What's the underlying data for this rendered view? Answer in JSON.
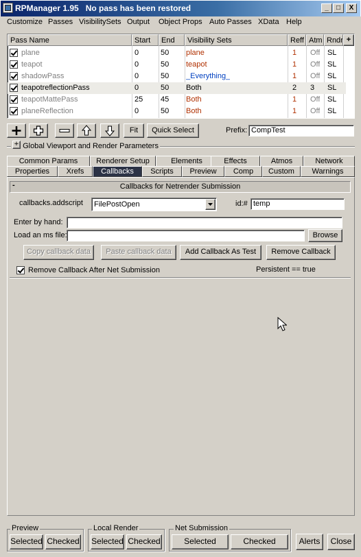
{
  "window": {
    "title": "RPManager 1.95   No pass has been restored",
    "minimize": "_",
    "maximize": "□",
    "close": "X"
  },
  "menu": [
    "Customize",
    "Passes",
    "VisibilitySets",
    "Output",
    "Object Props",
    "Auto Passes",
    "XData",
    "Help"
  ],
  "passes": {
    "headers": {
      "name": "Pass Name",
      "start": "Start",
      "end": "End",
      "vis": "Visibility Sets",
      "reff": "Reff",
      "atm": "Atm",
      "rndr": "Rndr"
    },
    "scroll_glyph": "+",
    "rows": [
      {
        "name": "plane",
        "start": "0",
        "end": "50",
        "vis": "plane",
        "reff": "1",
        "atm": "Off",
        "rndr": "SL"
      },
      {
        "name": "teapot",
        "start": "0",
        "end": "50",
        "vis": "teapot",
        "reff": "1",
        "atm": "Off",
        "rndr": "SL"
      },
      {
        "name": "shadowPass",
        "start": "0",
        "end": "50",
        "vis": "_Everything_",
        "reff": "1",
        "atm": "Off",
        "rndr": "SL"
      },
      {
        "name": "teapotreflectionPass",
        "start": "0",
        "end": "50",
        "vis": "Both",
        "reff": "2",
        "atm": "3",
        "rndr": "SL"
      },
      {
        "name": "teapotMattePass",
        "start": "25",
        "end": "45",
        "vis": "Both",
        "reff": "1",
        "atm": "Off",
        "rndr": "SL"
      },
      {
        "name": "planeReflection",
        "start": "0",
        "end": "50",
        "vis": "Both",
        "reff": "1",
        "atm": "Off",
        "rndr": "SL"
      }
    ]
  },
  "toolbar": {
    "fit": "Fit",
    "quick_select": "Quick Select",
    "prefix_label": "Prefix:",
    "prefix_value": "CompTest"
  },
  "rollout_global": {
    "toggle": "+",
    "label": "Global Viewport and Render Parameters"
  },
  "tabs_row1": [
    "Common Params",
    "Renderer Setup",
    "Elements",
    "Effects",
    "Atmos",
    "Network"
  ],
  "tabs_row2": [
    "Properties",
    "Xrefs",
    "Callbacks",
    "Scripts",
    "Preview",
    "Comp",
    "Custom",
    "Warnings"
  ],
  "callbacks": {
    "rollout_toggle": "-",
    "rollout_title": "Callbacks for Netrender Submission",
    "addscript_label": "callbacks.addscript",
    "addscript_value": "FilePostOpen",
    "id_label": "id:#",
    "id_value": "temp",
    "hand_label": "Enter by hand:",
    "hand_value": "",
    "msfile_label": "Load an ms file:",
    "msfile_value": "",
    "browse": "Browse",
    "copy": "Copy callback data",
    "paste": "Paste callback data",
    "add_test": "Add Callback As Test",
    "remove": "Remove Callback",
    "remove_after_label": "Remove Callback After Net Submission",
    "persistent": "Persistent == true"
  },
  "bottom": {
    "preview": {
      "title": "Preview",
      "selected": "Selected",
      "checked": "Checked"
    },
    "local": {
      "title": "Local Render",
      "selected": "Selected",
      "checked": "Checked"
    },
    "net": {
      "title": "Net Submission",
      "selected": "Selected",
      "checked": "Checked"
    },
    "alerts": "Alerts",
    "close": "Close"
  },
  "colors": {
    "orange_vis": "#b03000",
    "blue_vis": "#0040c0",
    "gray_text": "#808080",
    "active_tab": "#2c3346"
  }
}
